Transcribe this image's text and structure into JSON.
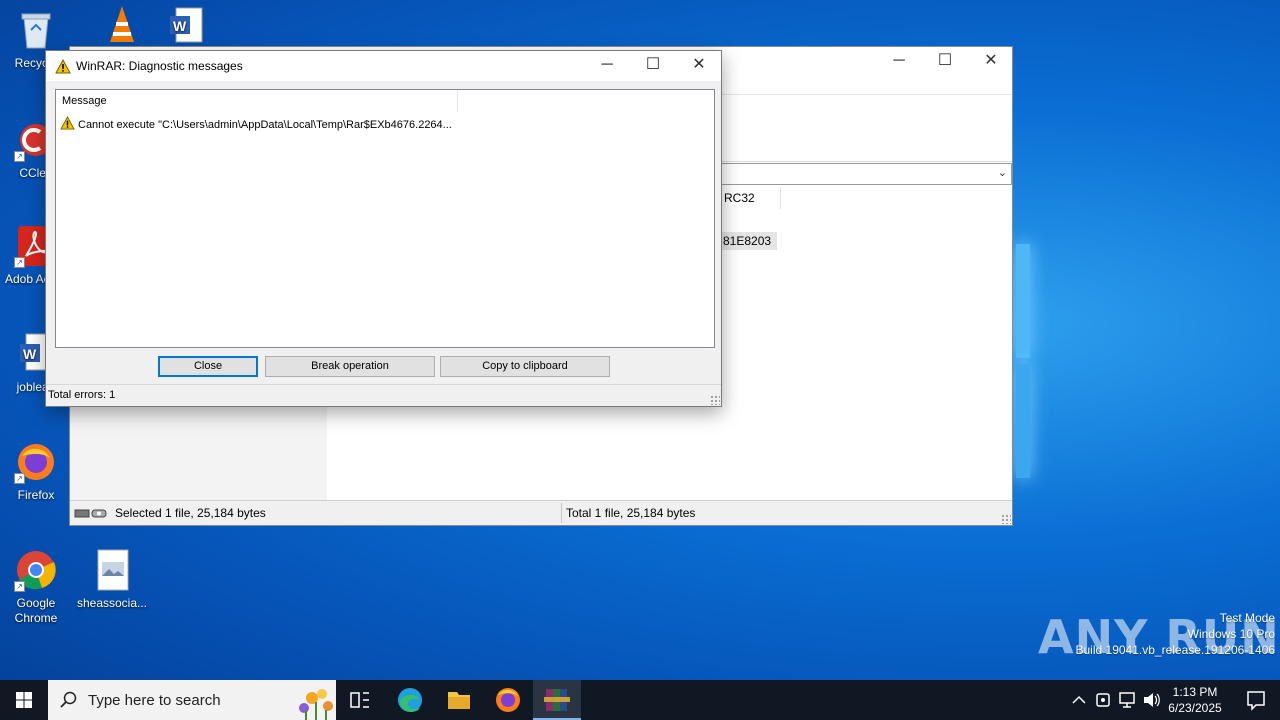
{
  "desktop": {
    "icons": [
      {
        "label": "Recycle"
      },
      {
        "label": "CClea"
      },
      {
        "label": "Adob Acrob"
      },
      {
        "label": "jobleag"
      },
      {
        "label": "Firefox"
      },
      {
        "label": "Google Chrome"
      },
      {
        "label": "sheassocia..."
      }
    ]
  },
  "main_window": {
    "column_crc": "RC32",
    "cell_crc": "81E8203",
    "status_selected": "Selected 1 file, 25,184 bytes",
    "status_total": "Total 1 file, 25,184 bytes"
  },
  "dialog": {
    "title": "WinRAR: Diagnostic messages",
    "column_message": "Message",
    "messages": [
      {
        "text": "Cannot execute \"C:\\Users\\admin\\AppData\\Local\\Temp\\Rar$EXb4676.2264..."
      }
    ],
    "buttons": {
      "close": "Close",
      "break": "Break operation",
      "copy": "Copy to clipboard"
    },
    "total_errors": "Total errors: 1"
  },
  "watermark": {
    "logo": "ANY RUN",
    "line1": "Test Mode",
    "line2": "Windows 10 Pro",
    "line3": "Build 19041.vb_release.191206-1406"
  },
  "taskbar": {
    "search_placeholder": "Type here to search",
    "time": "1:13 PM",
    "date": "6/23/2025"
  },
  "colors": {
    "accent": "#0078d7",
    "warning": "#f5c400"
  }
}
